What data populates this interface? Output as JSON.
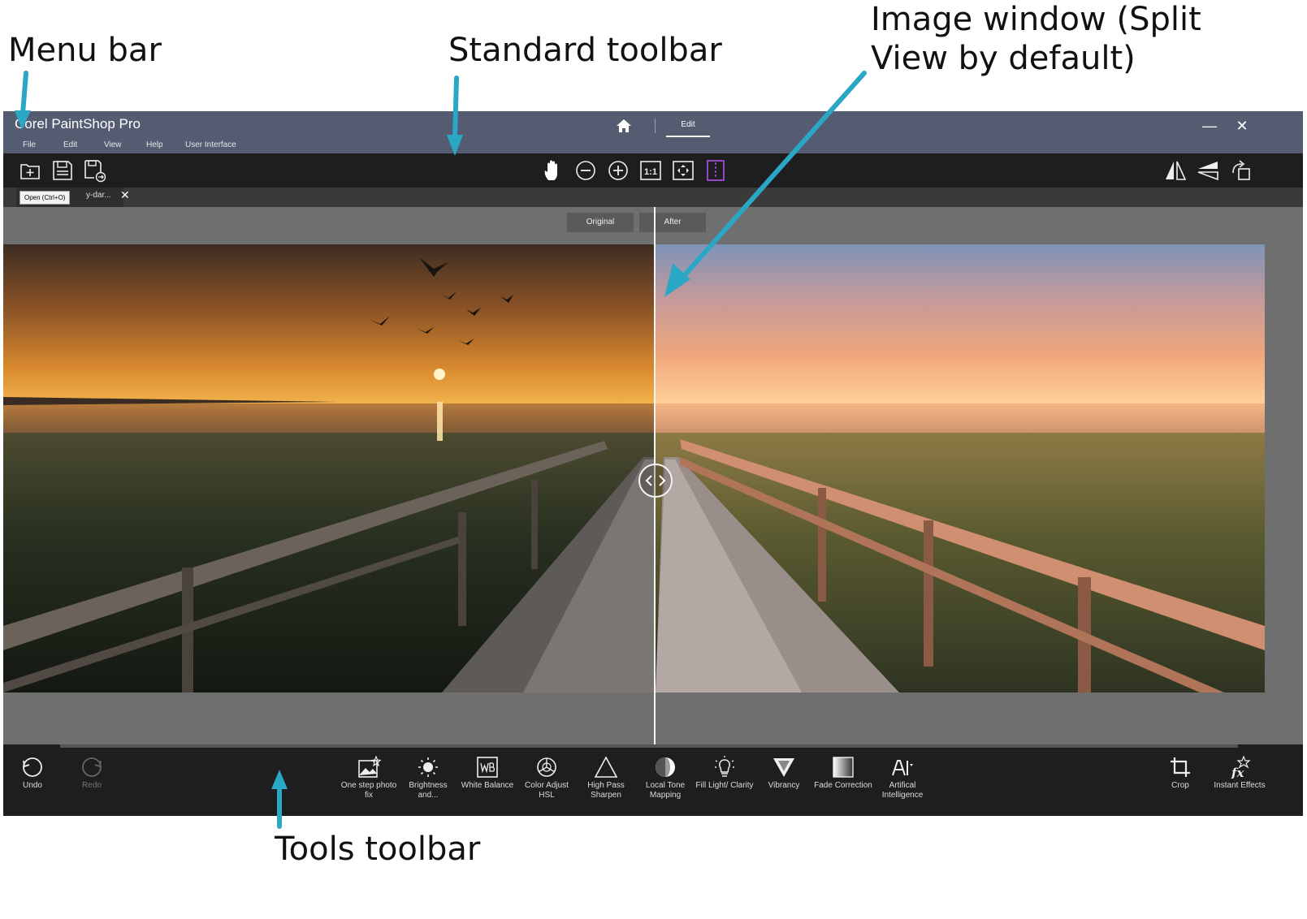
{
  "callouts": {
    "menu_bar": "Menu bar",
    "standard_toolbar": "Standard toolbar",
    "image_window": "Image window (Split View by default)",
    "tools_toolbar": "Tools toolbar"
  },
  "app": {
    "title": "Corel PaintShop Pro",
    "mode_tab": "Edit",
    "icons": [
      "home-icon",
      "minimize-icon",
      "close-icon"
    ]
  },
  "menu": {
    "items": [
      "File",
      "Edit",
      "View",
      "Help",
      "User Interface"
    ]
  },
  "standard_toolbar": {
    "left_icons": [
      "new-image-icon",
      "save-icon",
      "save-as-icon"
    ],
    "center_icons": [
      "pan-hand-icon",
      "zoom-out-icon",
      "zoom-in-icon",
      "actual-size-icon",
      "fit-window-icon",
      "split-view-icon"
    ],
    "right_icons": [
      "flip-horizontal-icon",
      "flip-vertical-icon",
      "rotate-icon"
    ],
    "one_to_one": "1:1"
  },
  "document": {
    "tab_name": "y-dar...",
    "tooltip": "Open (Ctrl+O)"
  },
  "split_view": {
    "left_label": "Original",
    "right_label": "After"
  },
  "tools": [
    {
      "label": "Undo",
      "icon": "undo-icon",
      "enabled": true
    },
    {
      "label": "Redo",
      "icon": "redo-icon",
      "enabled": false
    },
    {
      "label": "One step photo fix",
      "icon": "one-step-photo-fix-icon",
      "enabled": true
    },
    {
      "label": "Brightness and...",
      "icon": "brightness-icon",
      "enabled": true
    },
    {
      "label": "White Balance",
      "icon": "white-balance-icon",
      "enabled": true
    },
    {
      "label": "Color Adjust HSL",
      "icon": "color-adjust-icon",
      "enabled": true
    },
    {
      "label": "High Pass Sharpen",
      "icon": "high-pass-sharpen-icon",
      "enabled": true
    },
    {
      "label": "Local Tone Mapping",
      "icon": "local-tone-mapping-icon",
      "enabled": true
    },
    {
      "label": "Fill Light/ Clarity",
      "icon": "fill-light-icon",
      "enabled": true
    },
    {
      "label": "Vibrancy",
      "icon": "vibrancy-icon",
      "enabled": true
    },
    {
      "label": "Fade Correction",
      "icon": "fade-correction-icon",
      "enabled": true
    },
    {
      "label": "Artifical Intelligence",
      "icon": "ai-icon",
      "enabled": true
    },
    {
      "label": "Crop",
      "icon": "crop-icon",
      "enabled": true
    },
    {
      "label": "Instant Effects",
      "icon": "instant-effects-icon",
      "enabled": true
    }
  ],
  "colors": {
    "titlebar": "#555c72",
    "toolbar": "#1e1e1e",
    "canvas": "#6f6f6f",
    "accent": "#2aa7c4",
    "split_icon": "#a24bd6"
  }
}
